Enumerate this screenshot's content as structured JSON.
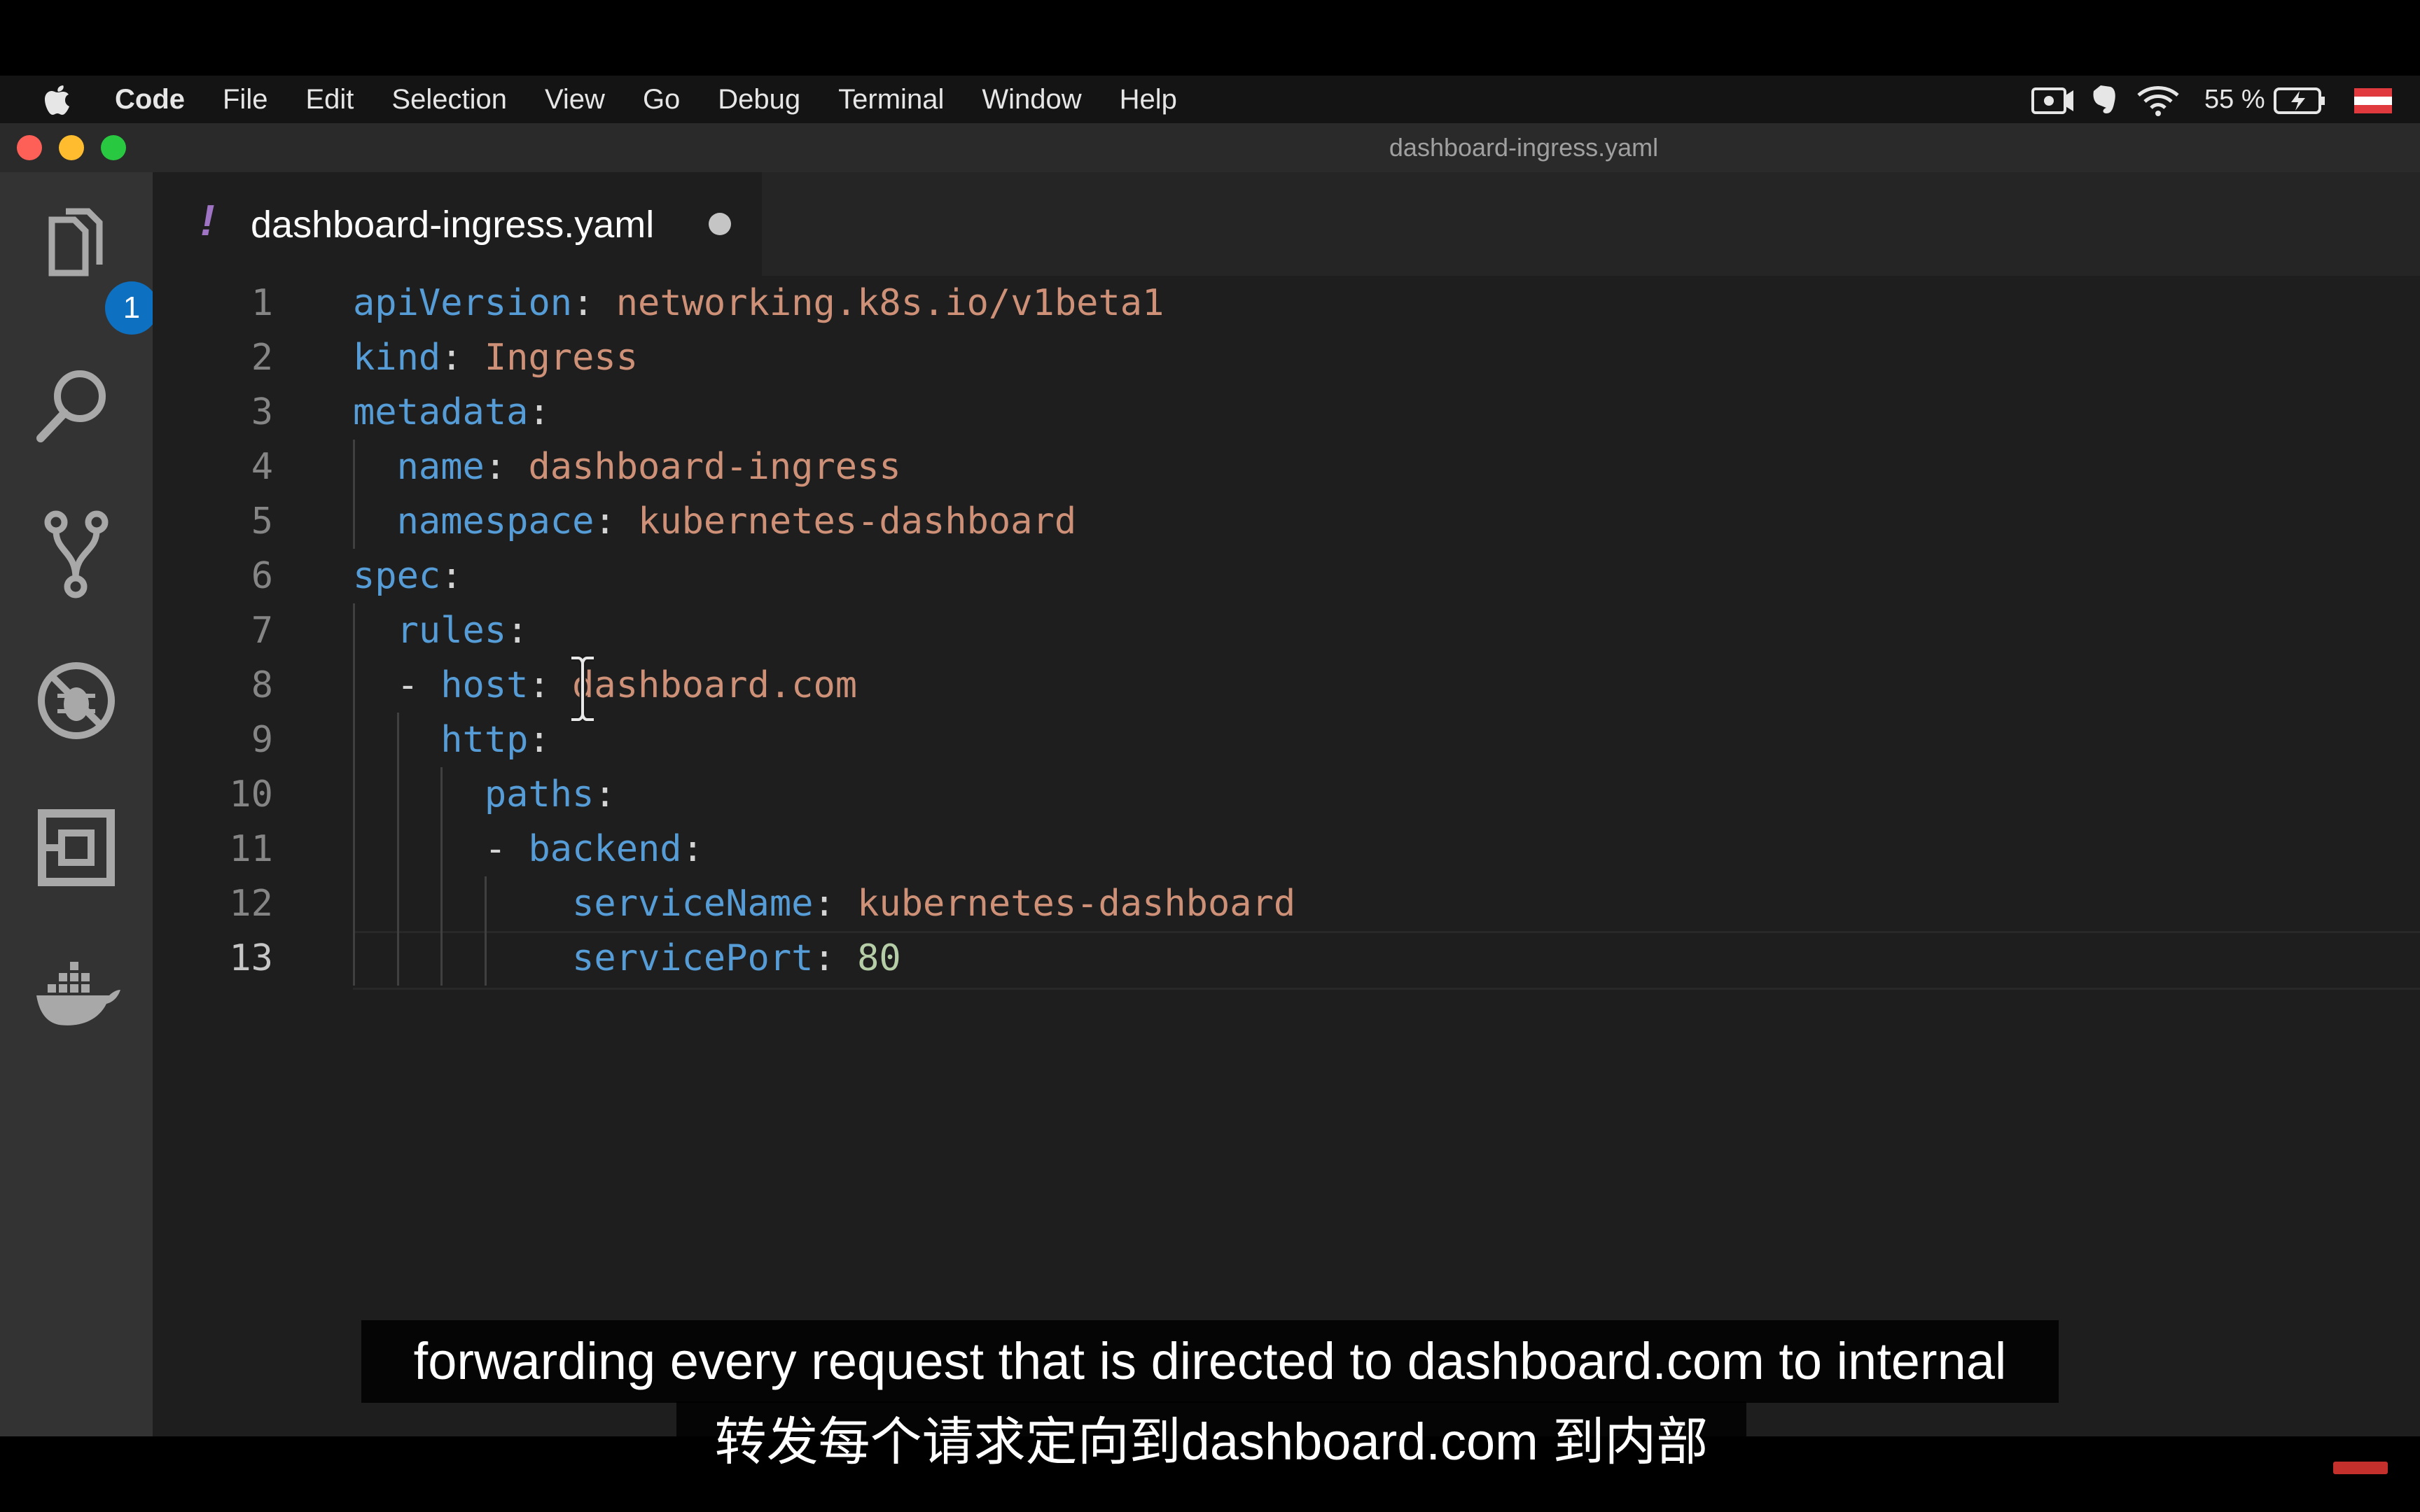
{
  "menubar": {
    "app": "Code",
    "items": [
      "File",
      "Edit",
      "Selection",
      "View",
      "Go",
      "Debug",
      "Terminal",
      "Window",
      "Help"
    ],
    "battery": "55 %"
  },
  "window": {
    "title": "dashboard-ingress.yaml"
  },
  "activitybar": {
    "explorer_badge": "1",
    "icons": [
      "files-icon",
      "search-icon",
      "source-control-icon",
      "debug-icon",
      "extensions-icon",
      "docker-icon"
    ]
  },
  "editor": {
    "tab": {
      "marker": "!",
      "filename": "dashboard-ingress.yaml",
      "modified": true
    },
    "active_line": 13,
    "lines": [
      {
        "n": "1",
        "key": "apiVersion",
        "value": "networking.k8s.io/v1beta1"
      },
      {
        "n": "2",
        "key": "kind",
        "value": "Ingress"
      },
      {
        "n": "3",
        "key": "metadata",
        "value": ""
      },
      {
        "n": "4",
        "key": "name",
        "value": "dashboard-ingress"
      },
      {
        "n": "5",
        "key": "namespace",
        "value": "kubernetes-dashboard"
      },
      {
        "n": "6",
        "key": "spec",
        "value": ""
      },
      {
        "n": "7",
        "key": "rules",
        "value": ""
      },
      {
        "n": "8",
        "key": "host",
        "value": "dashboard.com"
      },
      {
        "n": "9",
        "key": "http",
        "value": ""
      },
      {
        "n": "10",
        "key": "paths",
        "value": ""
      },
      {
        "n": "11",
        "key": "backend",
        "value": ""
      },
      {
        "n": "12",
        "key": "serviceName",
        "value": "kubernetes-dashboard"
      },
      {
        "n": "13",
        "key": "servicePort",
        "value": "80"
      }
    ]
  },
  "subtitles": {
    "en": "forwarding every request that is directed to dashboard.com to internal",
    "zh": "转发每个请求定向到dashboard.com 到内部"
  },
  "colors": {
    "key": "#569cd6",
    "string": "#ce9178",
    "number": "#b5cea8",
    "accent_badge": "#0e70c0",
    "marker": "#a074c4"
  }
}
